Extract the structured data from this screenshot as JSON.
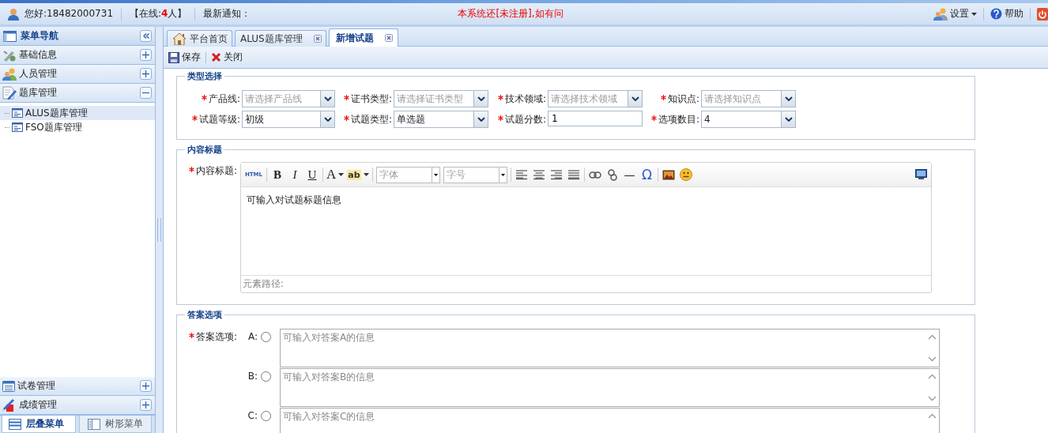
{
  "header": {
    "greeting": "您好:18482000731",
    "online": {
      "prefix": "【在线:",
      "count": "4",
      "suffix": "人】"
    },
    "notice_label": "最新通知：",
    "notice": "本系统还[未注册],如有问",
    "actions": [
      {
        "kind": "settings",
        "label": "设置",
        "menu": true
      },
      {
        "kind": "help",
        "label": "帮助",
        "menu": false
      },
      {
        "kind": "power"
      }
    ]
  },
  "sidebar": {
    "title": "菜单导航",
    "groups": [
      {
        "kind": "basic",
        "label": "基础信息",
        "expanded": false
      },
      {
        "kind": "people",
        "label": "人员管理",
        "expanded": false
      },
      {
        "kind": "bank",
        "label": "题库管理",
        "expanded": true,
        "children": [
          {
            "label": "ALUS题库管理",
            "selected": true
          },
          {
            "label": "FSO题库管理",
            "selected": false
          }
        ]
      }
    ],
    "bottom_groups": [
      {
        "kind": "paper",
        "label": "试卷管理",
        "expanded": false
      },
      {
        "kind": "score",
        "label": "成绩管理",
        "expanded": false
      }
    ],
    "bottom_tabs": [
      {
        "kind": "stack",
        "label": "层叠菜单",
        "selected": true
      },
      {
        "kind": "tree",
        "label": "树形菜单",
        "selected": false
      }
    ]
  },
  "tabs": [
    {
      "kind": "home",
      "label": "平台首页",
      "selected": false,
      "closable": false
    },
    {
      "kind": "page",
      "label": "ALUS题库管理",
      "selected": false,
      "closable": true
    },
    {
      "kind": "page",
      "label": "新增试题",
      "selected": true,
      "closable": true
    }
  ],
  "toolbar": [
    {
      "kind": "save",
      "label": "保存"
    },
    {
      "kind": "close",
      "label": "关闭"
    }
  ],
  "type_selection": {
    "title": "类型选择",
    "fields": [
      {
        "label": "产品线:",
        "required": true,
        "kind": "select",
        "placeholder": "请选择产品线"
      },
      {
        "label": "证书类型:",
        "required": true,
        "kind": "select",
        "placeholder": "请选择证书类型"
      },
      {
        "label": "技术领域:",
        "required": true,
        "kind": "select",
        "placeholder": "请选择技术领域"
      },
      {
        "label": "知识点:",
        "required": true,
        "kind": "select",
        "placeholder": "请选择知识点"
      },
      {
        "label": "试题等级:",
        "required": true,
        "kind": "select",
        "value": "初级"
      },
      {
        "label": "试题类型:",
        "required": true,
        "kind": "select",
        "value": "单选题"
      },
      {
        "label": "试题分数:",
        "required": true,
        "kind": "text",
        "value": "1"
      },
      {
        "label": "选项数目:",
        "required": true,
        "kind": "select",
        "value": "4"
      }
    ]
  },
  "content_title": {
    "title": "内容标题",
    "label": "内容标题:",
    "required": true,
    "editor": {
      "toolbar": [
        {
          "kind": "html",
          "label": "HTML"
        },
        {
          "kind": "sep"
        },
        {
          "kind": "bold",
          "label": "B"
        },
        {
          "kind": "italic",
          "label": "I"
        },
        {
          "kind": "underline",
          "label": "U"
        },
        {
          "kind": "sep"
        },
        {
          "kind": "forecolor",
          "label": "A"
        },
        {
          "kind": "highlight",
          "label": "ab"
        },
        {
          "kind": "sep"
        },
        {
          "kind": "combo",
          "placeholder": "字体"
        },
        {
          "kind": "combo",
          "placeholder": "字号"
        },
        {
          "kind": "sep"
        },
        {
          "kind": "align-left"
        },
        {
          "kind": "align-center"
        },
        {
          "kind": "align-right"
        },
        {
          "kind": "justify"
        },
        {
          "kind": "sep"
        },
        {
          "kind": "link"
        },
        {
          "kind": "unlink"
        },
        {
          "kind": "rule",
          "label": "—"
        },
        {
          "kind": "special",
          "label": "Ω"
        },
        {
          "kind": "sep"
        },
        {
          "kind": "image"
        },
        {
          "kind": "emotion"
        },
        {
          "kind": "fullscreen"
        }
      ],
      "body": "可输入对试题标题信息",
      "path_label": "元素路径:"
    }
  },
  "answers": {
    "title": "答案选项",
    "label": "答案选项:",
    "required": true,
    "options": [
      {
        "letter": "A:",
        "selected": false,
        "placeholder": "可输入对答案A的信息"
      },
      {
        "letter": "B:",
        "selected": false,
        "placeholder": "可输入对答案B的信息"
      },
      {
        "letter": "C:",
        "selected": false,
        "placeholder": "可输入对答案C的信息"
      }
    ]
  }
}
